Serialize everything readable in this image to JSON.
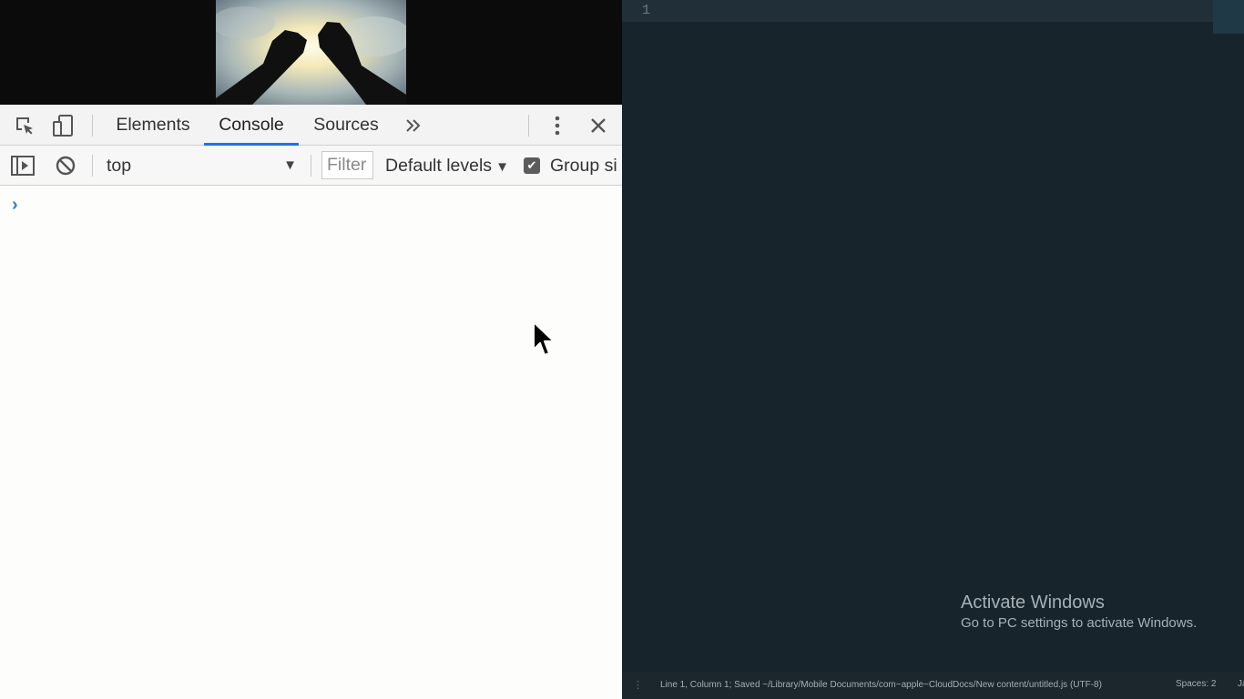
{
  "devtools": {
    "tabs": [
      {
        "label": "Elements",
        "active": false
      },
      {
        "label": "Console",
        "active": true
      },
      {
        "label": "Sources",
        "active": false
      }
    ],
    "more_tabs_icon": "double-chevron-right-icon",
    "console_toolbar": {
      "context": "top",
      "filter_placeholder": "Filter",
      "levels": "Default levels",
      "group_label": "Group si",
      "group_checked": true
    },
    "prompt_symbol": "›",
    "accent_color": "#1a73e8"
  },
  "editor": {
    "line_numbers": [
      "1"
    ],
    "status": {
      "position_text": "Line 1, Column 1; Saved ~/Library/Mobile Documents/com~apple~CloudDocs/New content/untitled.js (UTF-8)",
      "indent": "Spaces: 2",
      "syntax": "Ja"
    },
    "background_color": "#18242c"
  },
  "watermark": {
    "title": "Activate Windows",
    "subtitle": "Go to PC settings to activate Windows."
  }
}
